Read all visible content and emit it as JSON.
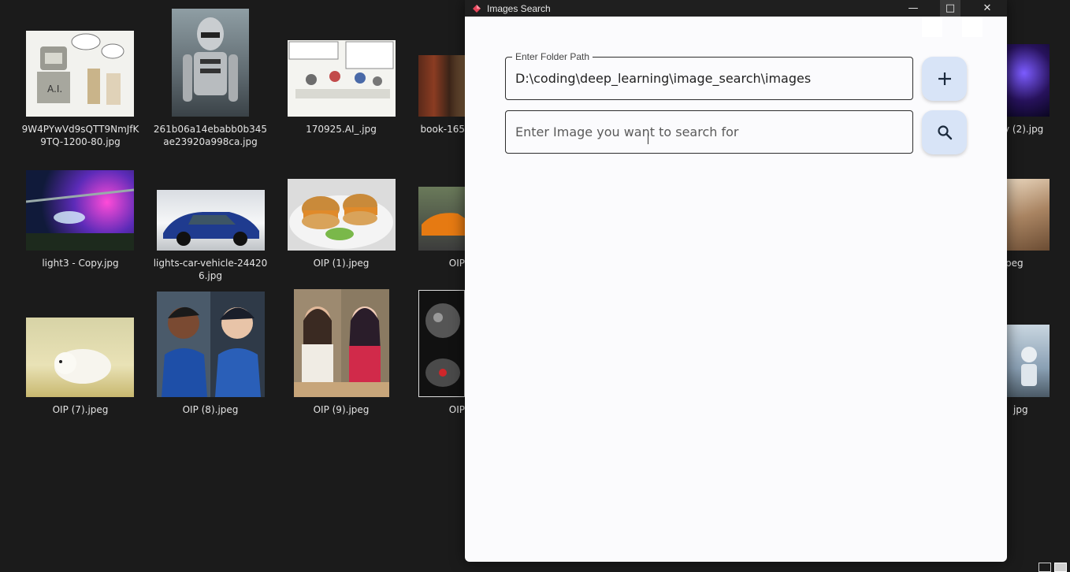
{
  "window": {
    "title": "Images Search",
    "controls": {
      "minimize": "—",
      "maximize": "□",
      "close": "✕"
    }
  },
  "folder_field": {
    "label": "Enter Folder Path",
    "value": "D:\\coding\\deep_learning\\image_search\\images"
  },
  "search_field": {
    "placeholder": "Enter Image you want to search for",
    "value": ""
  },
  "buttons": {
    "add_icon": "plus-icon",
    "search_icon": "search-icon"
  },
  "explorer": {
    "files": [
      "9W4PYwVd9sQTT9NmJfK9TQ-1200-80.jpg",
      "261b06a14ebabb0b345ae23920a998ca.jpg",
      "170925.AI_.jpg",
      "book-165",
      "y (2).jpg",
      "light3 - Copy.jpg",
      "lights-car-vehicle-244206.jpg",
      "OIP (1).jpeg",
      "OIP",
      "peg",
      "OIP (7).jpeg",
      "OIP (8).jpeg",
      "OIP (9).jpeg",
      "OIP",
      "jpg"
    ]
  },
  "colors": {
    "desktop_bg": "#1b1b1b",
    "window_bg": "#fbfbfd",
    "titlebar_bg": "#1f1f1f",
    "fab_bg": "#d8e4f7",
    "app_icon_accent": "#e5455a"
  }
}
